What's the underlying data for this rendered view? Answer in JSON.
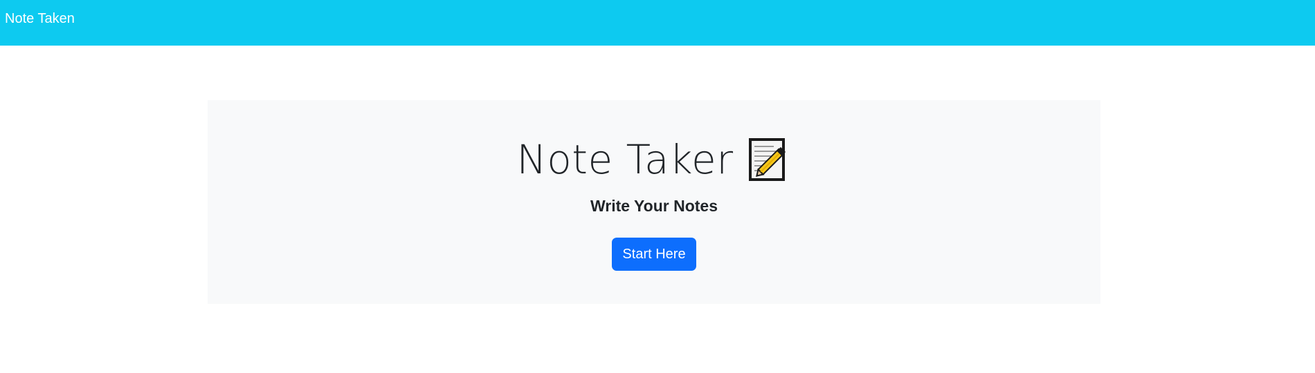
{
  "navbar": {
    "brand": "Note Taken",
    "background_color": "#0dcaf0"
  },
  "hero": {
    "title": "Note Taker",
    "title_icon": "memo-icon",
    "subtitle": "Write Your Notes",
    "cta_label": "Start Here",
    "background_color": "#f8f9fa",
    "cta_color": "#0d6efd"
  }
}
